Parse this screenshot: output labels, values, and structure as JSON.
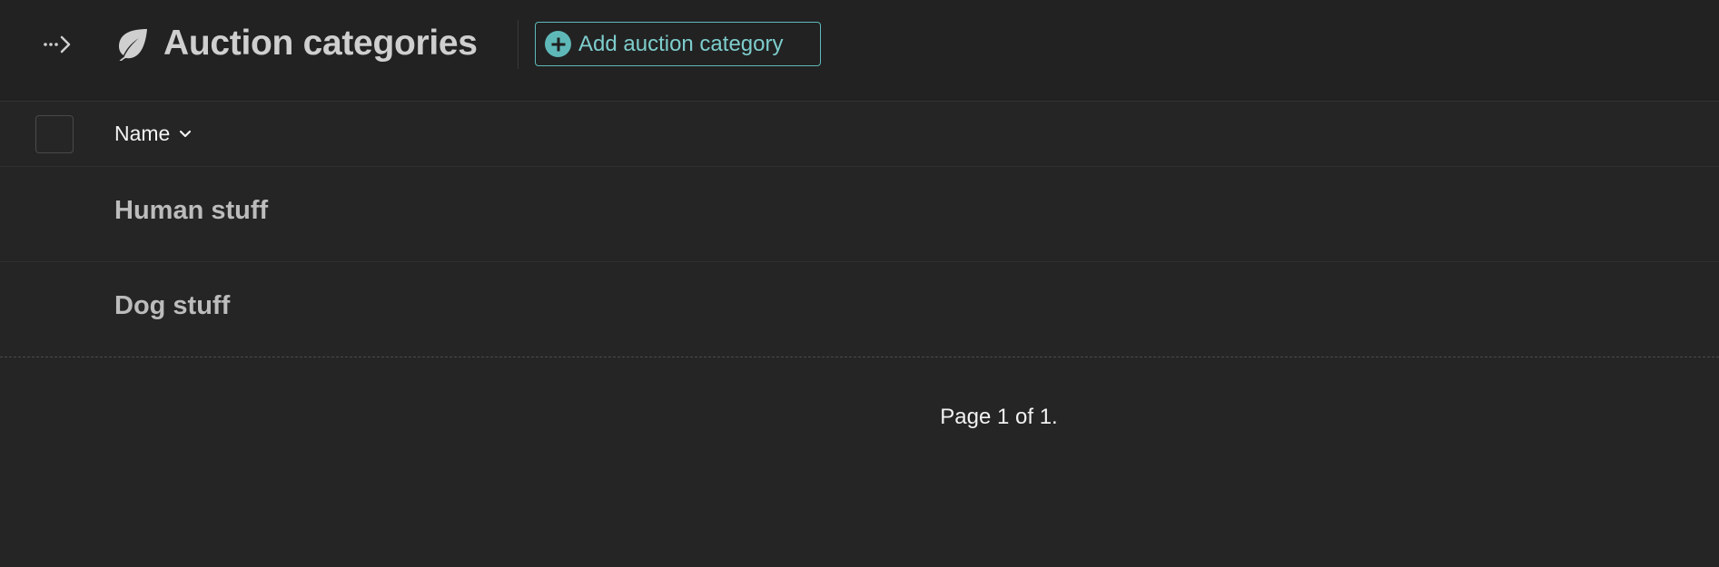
{
  "header": {
    "title": "Auction categories",
    "title_icon": "leaf-icon",
    "sidebar_toggle_icon": "sidebar-toggle-arrow-icon",
    "add_button_label": "Add auction category",
    "add_button_icon": "plus-circle-icon"
  },
  "table": {
    "columns": [
      {
        "label": "Name",
        "sort_icon": "chevron-down-icon"
      }
    ],
    "rows": [
      {
        "name": "Human stuff"
      },
      {
        "name": "Dog stuff"
      }
    ]
  },
  "pagination": {
    "text": "Page 1 of 1."
  },
  "colors": {
    "background": "#252525",
    "header_background": "#222222",
    "accent": "#5fb8b8",
    "accent_text": "#7ecdcd",
    "title_text": "#cfcfcf",
    "row_text": "#bcbcbc"
  }
}
